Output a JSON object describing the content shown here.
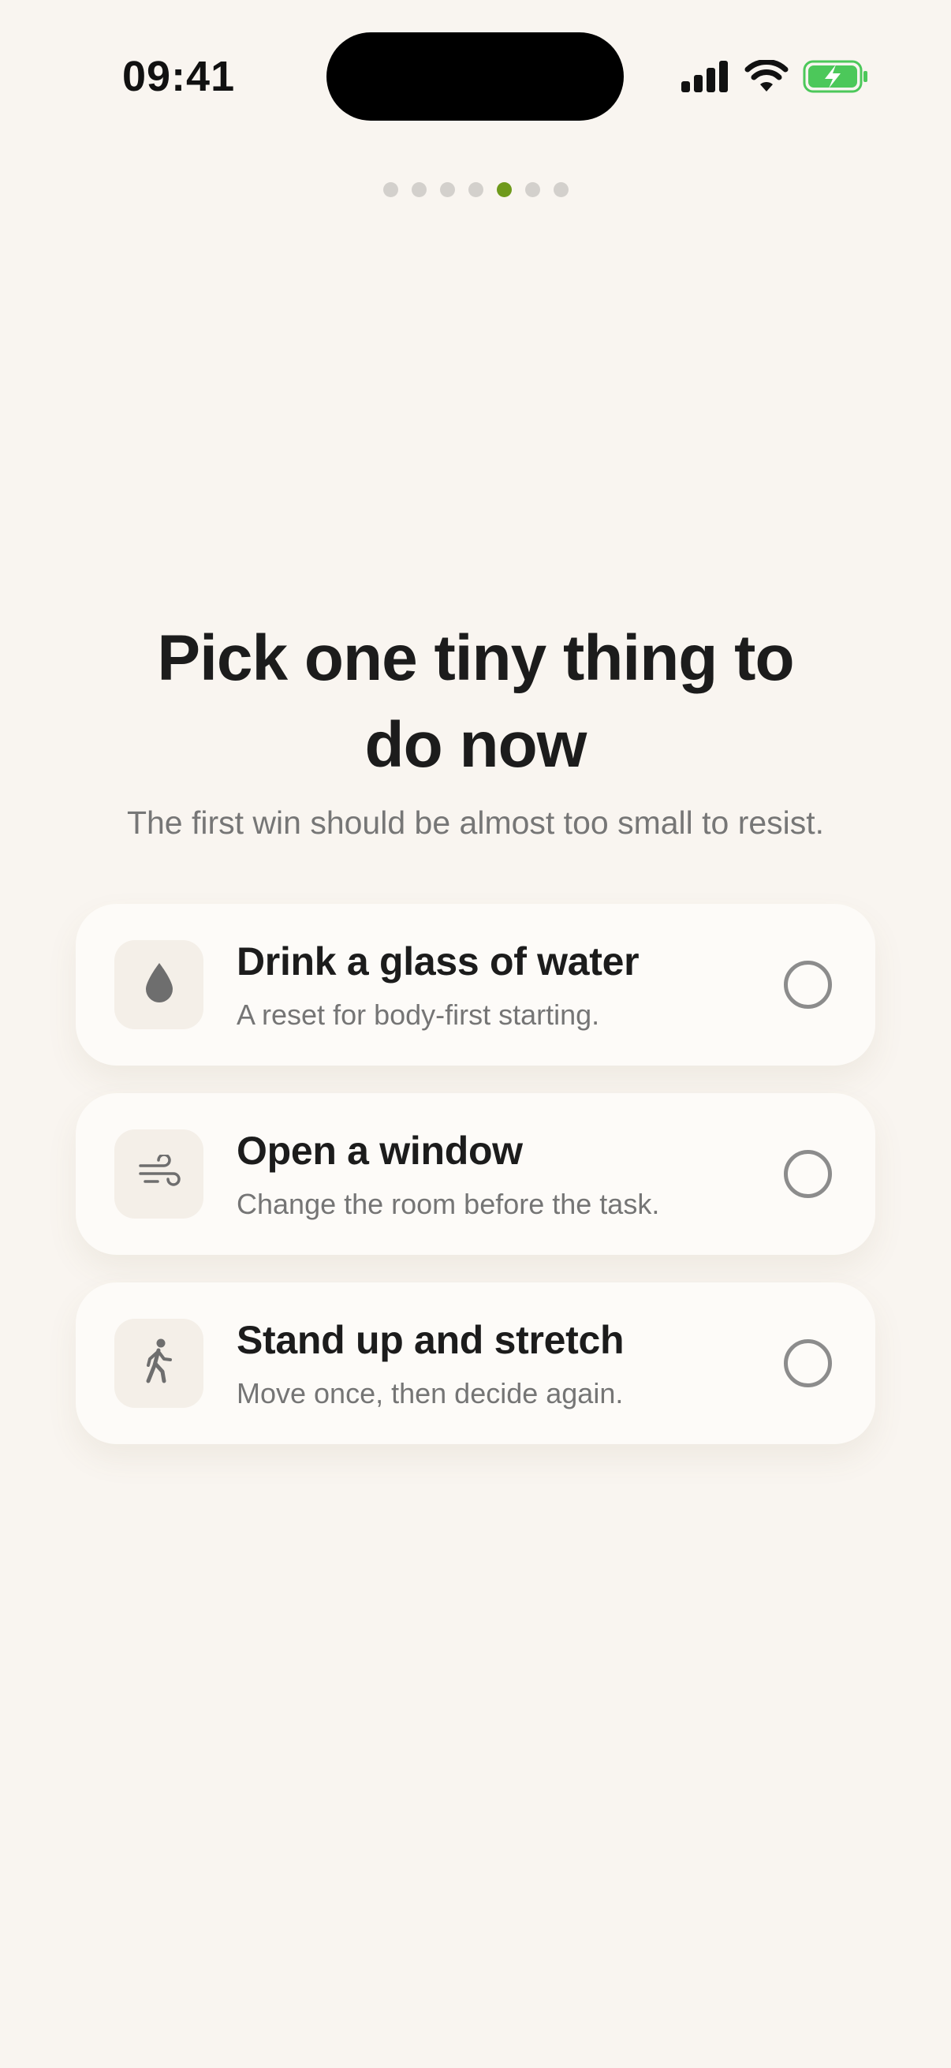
{
  "status_bar": {
    "time": "09:41"
  },
  "pager": {
    "total": 7,
    "active_index": 4,
    "active_color": "#6f9a1c"
  },
  "heading": {
    "title": "Pick one tiny thing to do now",
    "subtitle": "The first win should be almost too small to resist."
  },
  "options": [
    {
      "icon": "water-drop-icon",
      "title": "Drink a glass of water",
      "description": "A reset for body-first starting.",
      "selected": false
    },
    {
      "icon": "wind-icon",
      "title": "Open a window",
      "description": "Change the room before the task.",
      "selected": false
    },
    {
      "icon": "walking-person-icon",
      "title": "Stand up and stretch",
      "description": "Move once, then decide again.",
      "selected": false
    }
  ],
  "colors": {
    "background": "#f9f5f0",
    "card": "#fdfbf8",
    "battery": "#4cc85a"
  }
}
